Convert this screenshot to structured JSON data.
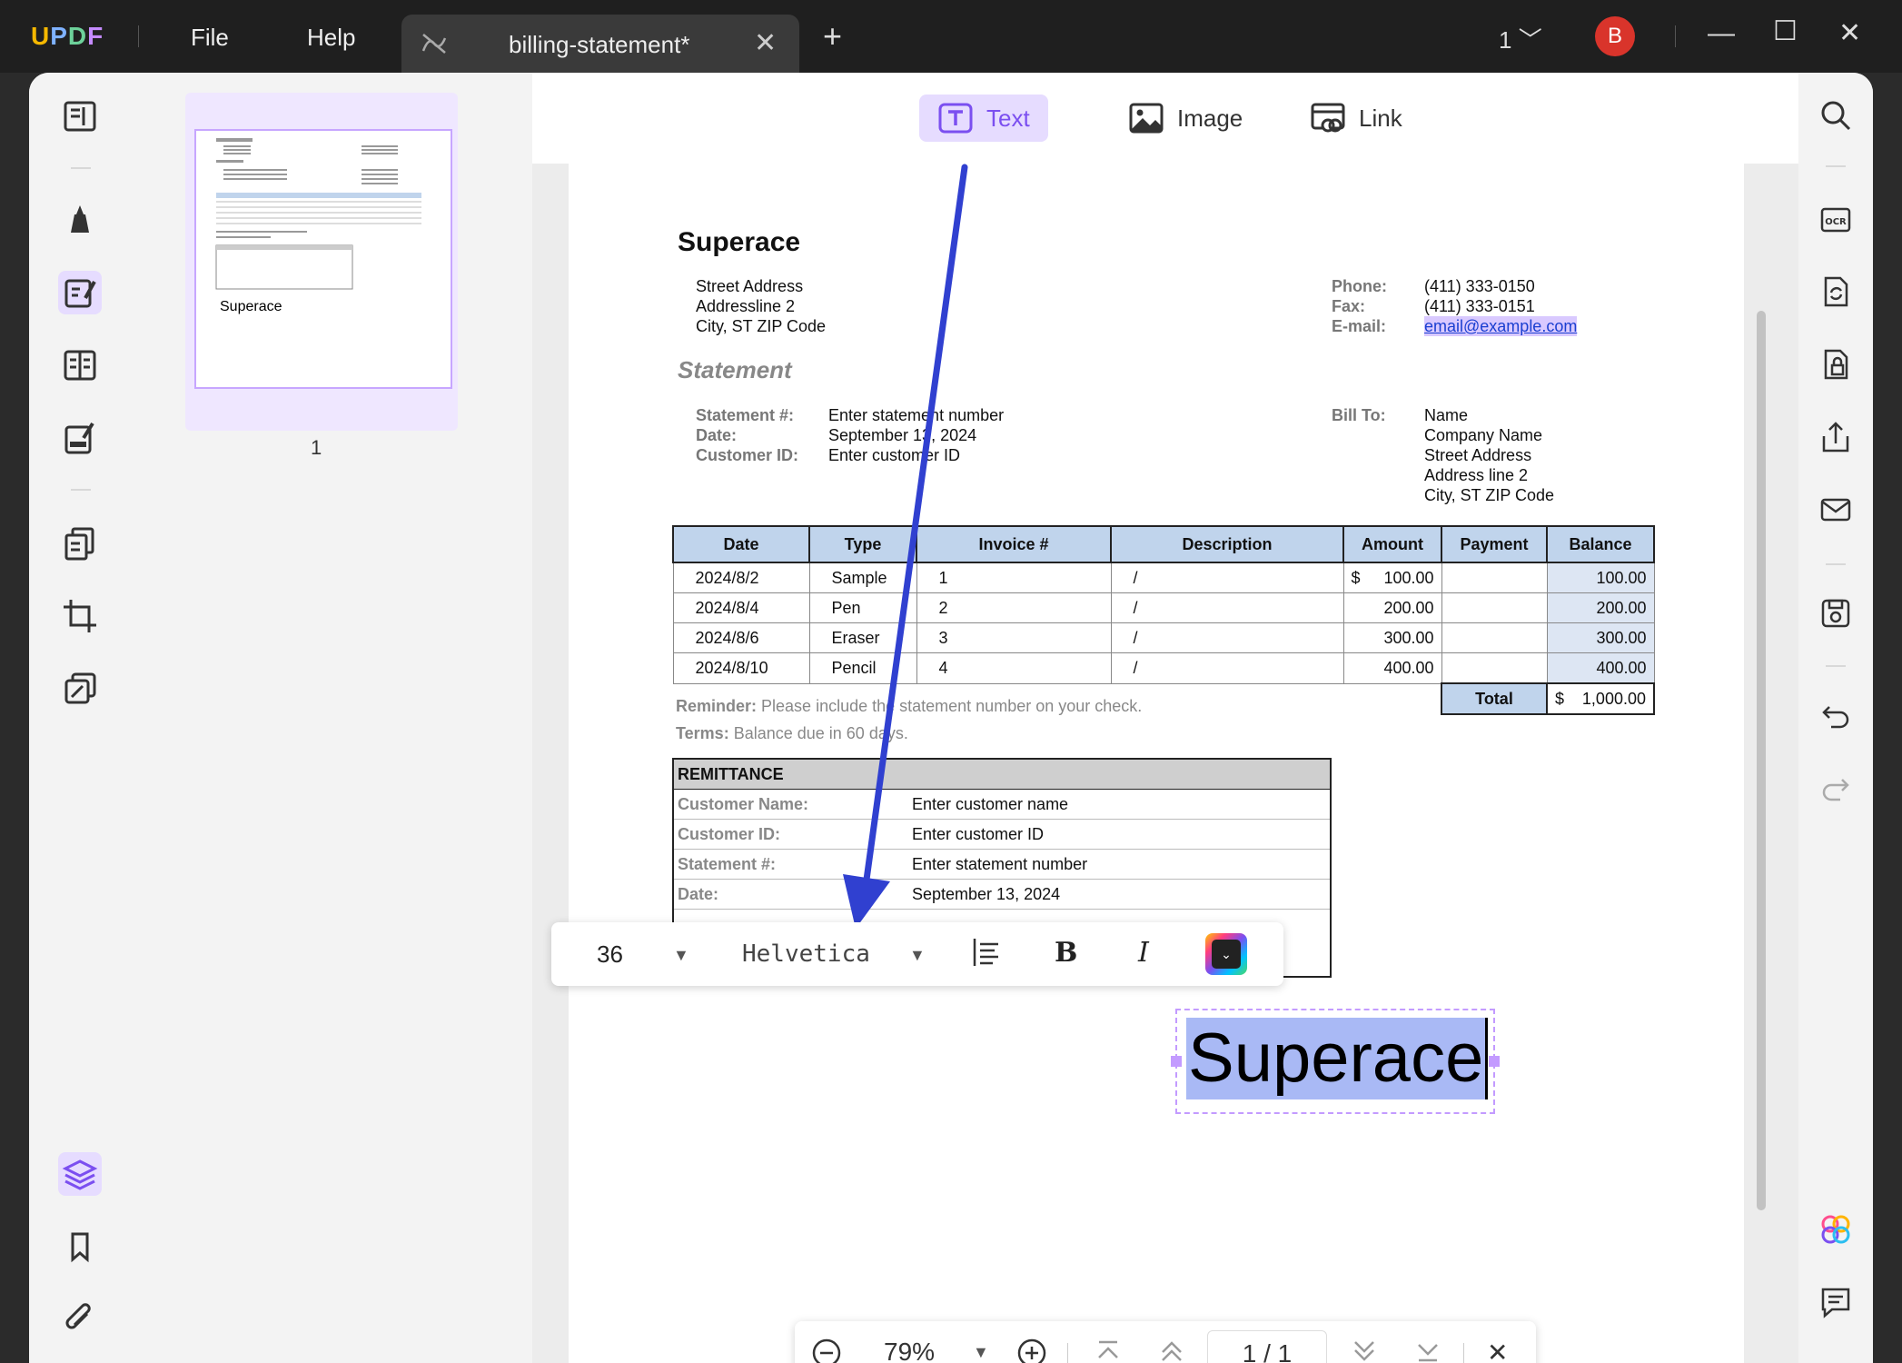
{
  "app": {
    "logo": "UPDF",
    "menu": [
      "File",
      "Help"
    ],
    "tab_title": "billing-statement*",
    "page_selector": "1",
    "avatar_letter": "B"
  },
  "toolbar": {
    "text": "Text",
    "image": "Image",
    "link": "Link"
  },
  "thumbnail": {
    "word": "Superace",
    "page_number": "1"
  },
  "document": {
    "company": "Superace",
    "address": [
      "Street Address",
      "Addressline  2",
      "City, ST  ZIP Code"
    ],
    "contact_labels": [
      "Phone:",
      "Fax:",
      "E-mail:"
    ],
    "contact_values": [
      "(411) 333-0150",
      "(411) 333-0151",
      "email@example.com"
    ],
    "statement_heading": "Statement",
    "statement_labels": [
      "Statement #:",
      "Date:",
      "Customer ID:"
    ],
    "statement_values": [
      "Enter statement number",
      "September 13, 2024",
      "Enter customer ID"
    ],
    "bill_to_label": "Bill To:",
    "bill_to_values": [
      "Name",
      "Company Name",
      "Street Address",
      "Address line 2",
      "City, ST  ZIP Code"
    ],
    "table": {
      "headers": [
        "Date",
        "Type",
        "Invoice #",
        "Description",
        "Amount",
        "Payment",
        "Balance"
      ],
      "rows": [
        {
          "date": "2024/8/2",
          "type": "Sample",
          "invoice": "1",
          "desc": "/",
          "cur": "$",
          "amount": "100.00",
          "payment": "",
          "balance": "100.00"
        },
        {
          "date": "2024/8/4",
          "type": "Pen",
          "invoice": "2",
          "desc": "/",
          "cur": "",
          "amount": "200.00",
          "payment": "",
          "balance": "200.00"
        },
        {
          "date": "2024/8/6",
          "type": "Eraser",
          "invoice": "3",
          "desc": "/",
          "cur": "",
          "amount": "300.00",
          "payment": "",
          "balance": "300.00"
        },
        {
          "date": "2024/8/10",
          "type": "Pencil",
          "invoice": "4",
          "desc": "/",
          "cur": "",
          "amount": "400.00",
          "payment": "",
          "balance": "400.00"
        }
      ],
      "total_label": "Total",
      "total_currency": "$",
      "total_value": "1,000.00"
    },
    "reminder_label": "Reminder:",
    "reminder_text": "Please include the statement number on your check.",
    "terms_label": "Terms:",
    "terms_text": "Balance due in 60 days.",
    "remittance_title": "REMITTANCE",
    "remittance_labels": [
      "Customer Name:",
      "Customer ID:",
      "Statement #:",
      "Date:"
    ],
    "remittance_values": [
      "Enter customer name",
      "Enter customer ID",
      "Enter statement number",
      "September 13, 2024"
    ],
    "selected_text": "Superace"
  },
  "format": {
    "size": "36",
    "font": "Helvetica",
    "bold": "B",
    "italic": "I"
  },
  "zoom": {
    "level": "79%",
    "page": "1 / 1"
  },
  "colors": {
    "accent": "#7b4ff0",
    "highlight": "#a9b9f5",
    "table_header": "#c0d4ec",
    "arrow": "#3040d0"
  }
}
